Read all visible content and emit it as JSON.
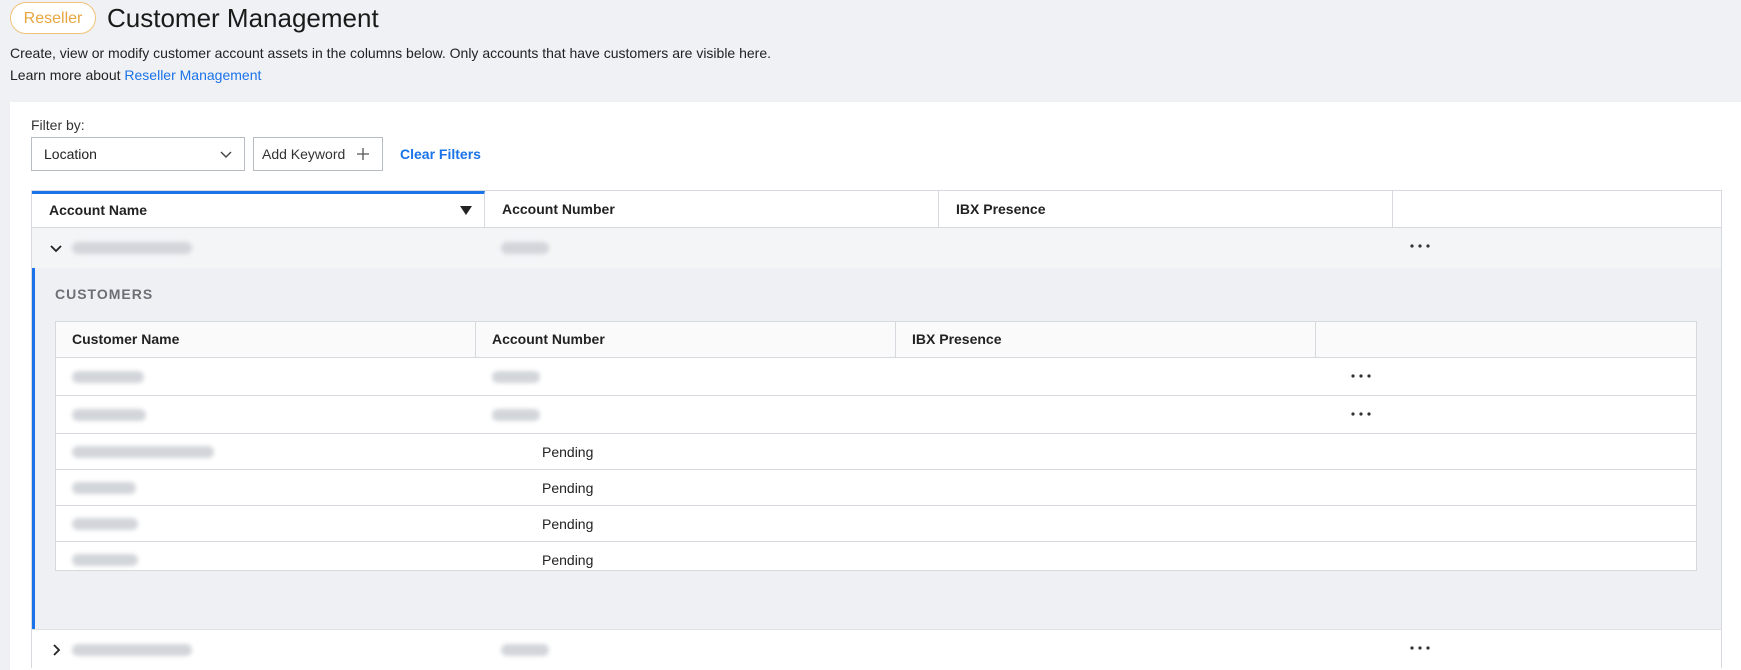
{
  "header": {
    "badge": "Reseller",
    "title": "Customer Management",
    "description": "Create, view or modify customer account assets in the columns below. Only accounts that have customers are visible here.",
    "learn_more_prefix": "Learn more about ",
    "learn_more_link": "Reseller Management"
  },
  "filters": {
    "label": "Filter by:",
    "location_select": "Location",
    "add_keyword": "Add Keyword",
    "clear_filters": "Clear Filters"
  },
  "table": {
    "columns": [
      "Account Name",
      "Account Number",
      "IBX Presence"
    ],
    "sorted_column": "Account Name"
  },
  "customers": {
    "section_title": "CUSTOMERS",
    "columns": [
      "Customer Name",
      "Account Number",
      "IBX Presence"
    ],
    "rows": [
      {
        "account_number": "",
        "has_menu": true
      },
      {
        "account_number": "",
        "has_menu": true
      },
      {
        "account_number": "Pending",
        "has_menu": false
      },
      {
        "account_number": "Pending",
        "has_menu": false
      },
      {
        "account_number": "Pending",
        "has_menu": false
      },
      {
        "account_number": "Pending",
        "has_menu": false
      }
    ]
  },
  "colors": {
    "accent": "#1a73e8",
    "badge": "#e7a640"
  },
  "icons": [
    "chevron-down-icon",
    "plus-icon",
    "sort-desc-icon",
    "chevron-right-icon",
    "more-options-icon"
  ]
}
